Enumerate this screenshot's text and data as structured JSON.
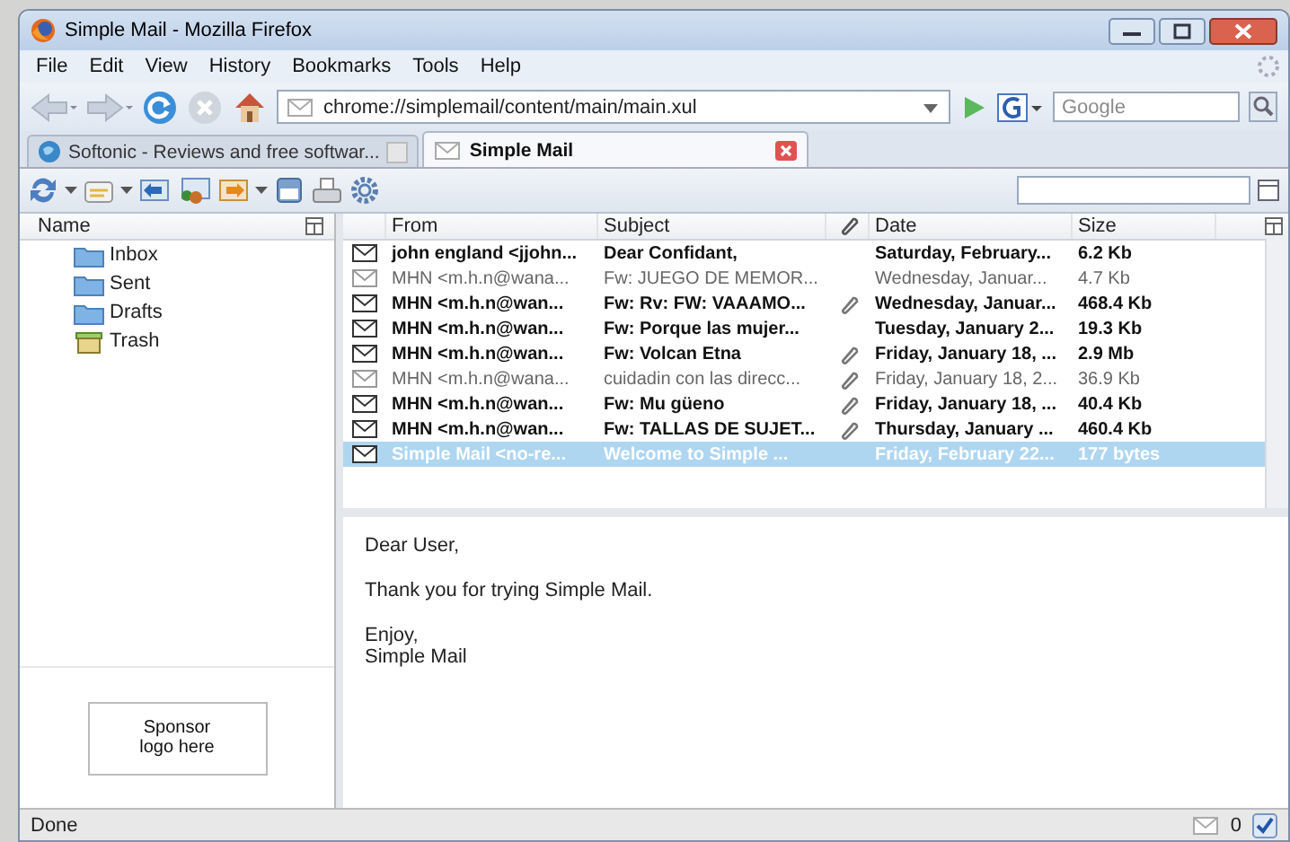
{
  "window": {
    "title": "Simple Mail - Mozilla Firefox"
  },
  "menu": [
    {
      "label": "File"
    },
    {
      "label": "Edit"
    },
    {
      "label": "View"
    },
    {
      "label": "History"
    },
    {
      "label": "Bookmarks"
    },
    {
      "label": "Tools"
    },
    {
      "label": "Help"
    }
  ],
  "address_bar": {
    "url": "chrome://simplemail/content/main/main.xul"
  },
  "search": {
    "placeholder": "Google"
  },
  "tabs": [
    {
      "label": "Softonic - Reviews and free softwar...",
      "selected": false
    },
    {
      "label": "Simple Mail",
      "selected": true
    }
  ],
  "folders": {
    "column": "Name",
    "items": [
      {
        "label": "Inbox",
        "kind": "folder"
      },
      {
        "label": "Sent",
        "kind": "folder"
      },
      {
        "label": "Drafts",
        "kind": "folder"
      },
      {
        "label": "Trash",
        "kind": "trash"
      }
    ]
  },
  "sponsor": "Sponsor\nlogo here",
  "messages": {
    "columns": [
      "From",
      "Subject",
      "Date",
      "Size"
    ],
    "rows": [
      {
        "from": "john england <jjohn...",
        "subject": "Dear Confidant,",
        "attachment": false,
        "date": "Saturday, February...",
        "size": "6.2 Kb",
        "read": false,
        "selected": false
      },
      {
        "from": "MHN <m.h.n@wana...",
        "subject": "Fw: JUEGO DE MEMOR...",
        "attachment": false,
        "date": "Wednesday, Januar...",
        "size": "4.7 Kb",
        "read": true,
        "selected": false
      },
      {
        "from": "MHN <m.h.n@wan...",
        "subject": "Fw: Rv: FW: VAAAMO...",
        "attachment": true,
        "date": "Wednesday, Januar...",
        "size": "468.4 Kb",
        "read": false,
        "selected": false
      },
      {
        "from": "MHN <m.h.n@wan...",
        "subject": "Fw: Porque las mujer...",
        "attachment": false,
        "date": "Tuesday, January 2...",
        "size": "19.3 Kb",
        "read": false,
        "selected": false
      },
      {
        "from": "MHN <m.h.n@wan...",
        "subject": "Fw: Volcan Etna",
        "attachment": true,
        "date": "Friday, January 18, ...",
        "size": "2.9 Mb",
        "read": false,
        "selected": false
      },
      {
        "from": "MHN <m.h.n@wana...",
        "subject": "cuidadin con las direcc...",
        "attachment": true,
        "date": "Friday, January 18, 2...",
        "size": "36.9 Kb",
        "read": true,
        "selected": false
      },
      {
        "from": "MHN <m.h.n@wan...",
        "subject": "Fw: Mu güeno",
        "attachment": true,
        "date": "Friday, January 18, ...",
        "size": "40.4 Kb",
        "read": false,
        "selected": false
      },
      {
        "from": "MHN <m.h.n@wan...",
        "subject": "Fw: TALLAS DE SUJET...",
        "attachment": true,
        "date": "Thursday, January ...",
        "size": "460.4 Kb",
        "read": false,
        "selected": false
      },
      {
        "from": "Simple Mail <no-re...",
        "subject": "Welcome to Simple ...",
        "attachment": false,
        "date": "Friday, February 22...",
        "size": "177 bytes",
        "read": false,
        "selected": true
      }
    ]
  },
  "preview": {
    "paragraphs": [
      "Dear User,",
      "Thank you for trying Simple Mail.",
      "Enjoy,\nSimple Mail"
    ]
  },
  "status_bar": {
    "text": "Done",
    "count": "0"
  }
}
